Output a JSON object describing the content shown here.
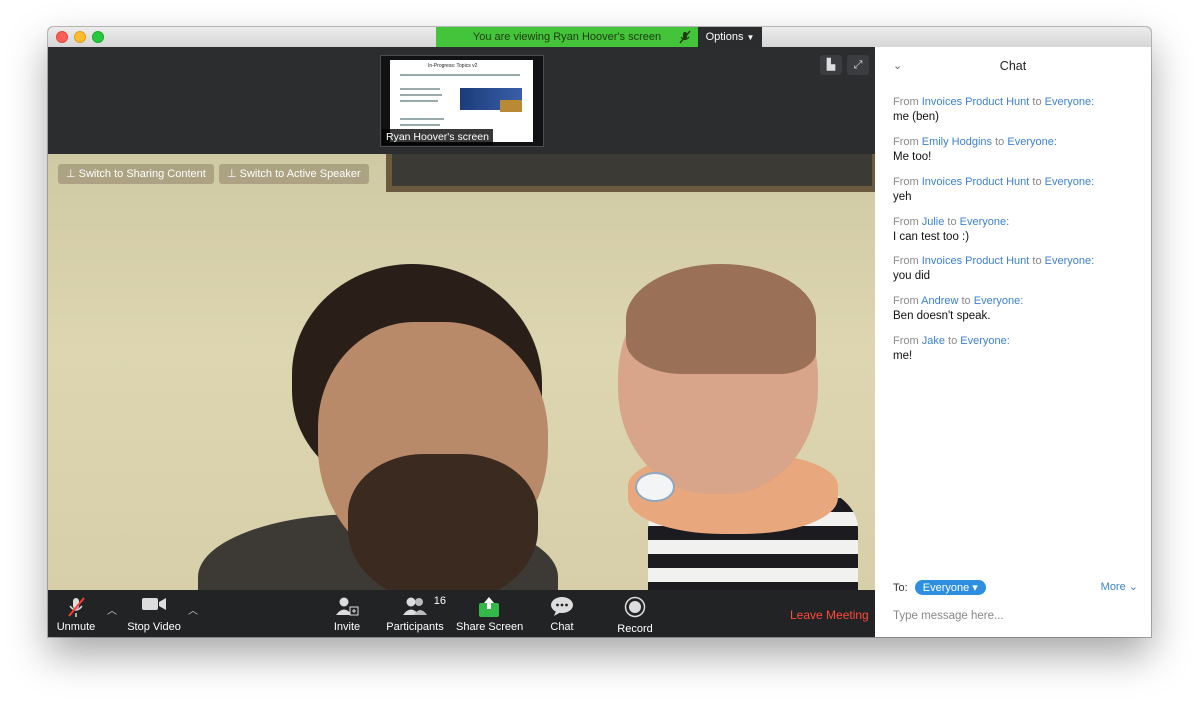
{
  "window": {
    "share_banner": "You are viewing Ryan Hoover's screen",
    "options_label": "Options"
  },
  "video": {
    "thumbnail_label": "Ryan Hoover's screen",
    "thumbnail_heading": "In-Progress: Topics v2",
    "switch_sharing": "Switch to Sharing Content",
    "switch_speaker": "Switch to Active Speaker",
    "toolbar": {
      "unmute": "Unmute",
      "stop_video": "Stop Video",
      "invite": "Invite",
      "participants": "Participants",
      "participants_count": "16",
      "share_screen": "Share Screen",
      "chat": "Chat",
      "record": "Record",
      "leave": "Leave Meeting"
    }
  },
  "chat": {
    "title": "Chat",
    "messages": [
      {
        "from": "From",
        "sender": "Invoices Product Hunt",
        "to": "to",
        "recipient": "Everyone:",
        "text": "me (ben)"
      },
      {
        "from": "From",
        "sender": "Emily Hodgins",
        "to": "to",
        "recipient": "Everyone:",
        "text": "Me too!"
      },
      {
        "from": "From",
        "sender": "Invoices Product Hunt",
        "to": "to",
        "recipient": "Everyone:",
        "text": "yeh"
      },
      {
        "from": "From",
        "sender": "Julie",
        "to": "to",
        "recipient": "Everyone:",
        "text": "I can test too :)"
      },
      {
        "from": "From",
        "sender": "Invoices Product Hunt",
        "to": "to",
        "recipient": "Everyone:",
        "text": "you did"
      },
      {
        "from": "From",
        "sender": "Andrew",
        "to": "to",
        "recipient": "Everyone:",
        "text": "Ben doesn't speak."
      },
      {
        "from": "From",
        "sender": "Jake",
        "to": "to",
        "recipient": "Everyone:",
        "text": "me!"
      }
    ],
    "to_label": "To:",
    "to_value": "Everyone",
    "more_label": "More",
    "input_placeholder": "Type message here..."
  },
  "colors": {
    "share_banner": "#44c43a",
    "link": "#3d82cf",
    "leave": "#ff4a3d",
    "pill": "#2e8ee0"
  }
}
